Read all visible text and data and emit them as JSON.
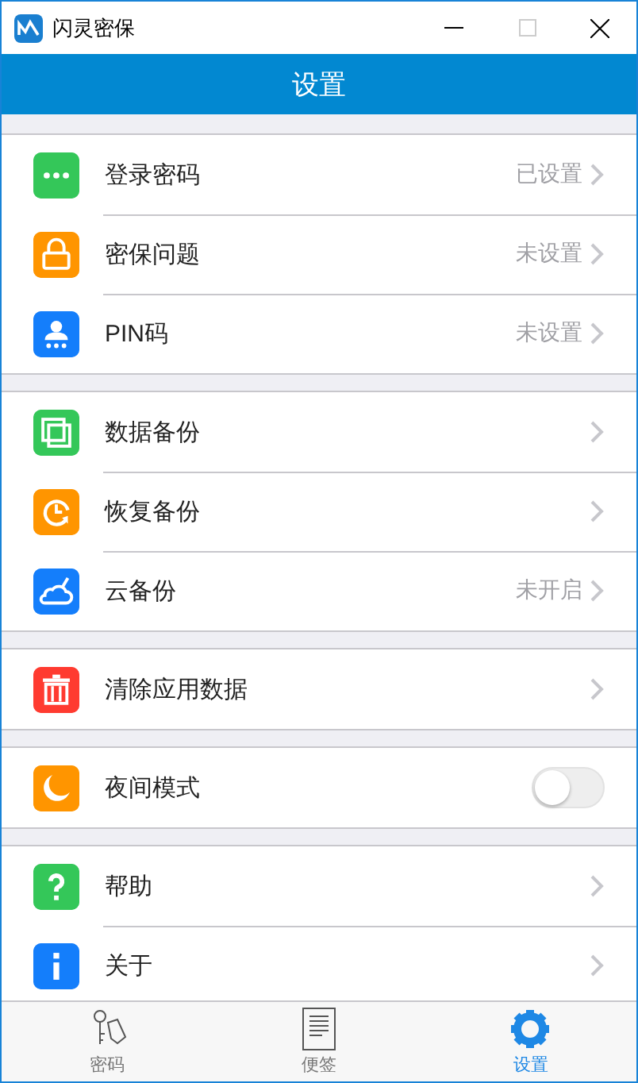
{
  "window": {
    "title": "闪灵密保"
  },
  "header": {
    "title": "设置"
  },
  "groups": [
    {
      "items": [
        {
          "label": "登录密码",
          "value": "已设置",
          "kind": "link",
          "color": "#34c759"
        },
        {
          "label": "密保问题",
          "value": "未设置",
          "kind": "link",
          "color": "#ff9500"
        },
        {
          "label": "PIN码",
          "value": "未设置",
          "kind": "link",
          "color": "#147efb"
        }
      ]
    },
    {
      "items": [
        {
          "label": "数据备份",
          "kind": "link",
          "color": "#34c759"
        },
        {
          "label": "恢复备份",
          "kind": "link",
          "color": "#ff9500"
        },
        {
          "label": "云备份",
          "value": "未开启",
          "kind": "link",
          "color": "#147efb"
        }
      ]
    },
    {
      "items": [
        {
          "label": "清除应用数据",
          "kind": "link",
          "color": "#ff3b30"
        }
      ]
    },
    {
      "items": [
        {
          "label": "夜间模式",
          "kind": "toggle",
          "on": false,
          "color": "#ff9500"
        }
      ]
    },
    {
      "items": [
        {
          "label": "帮助",
          "kind": "link",
          "color": "#34c759"
        },
        {
          "label": "关于",
          "kind": "link",
          "color": "#147efb"
        }
      ]
    }
  ],
  "tabs": [
    {
      "label": "密码",
      "selected": false
    },
    {
      "label": "便签",
      "selected": false
    },
    {
      "label": "设置",
      "selected": true
    }
  ]
}
